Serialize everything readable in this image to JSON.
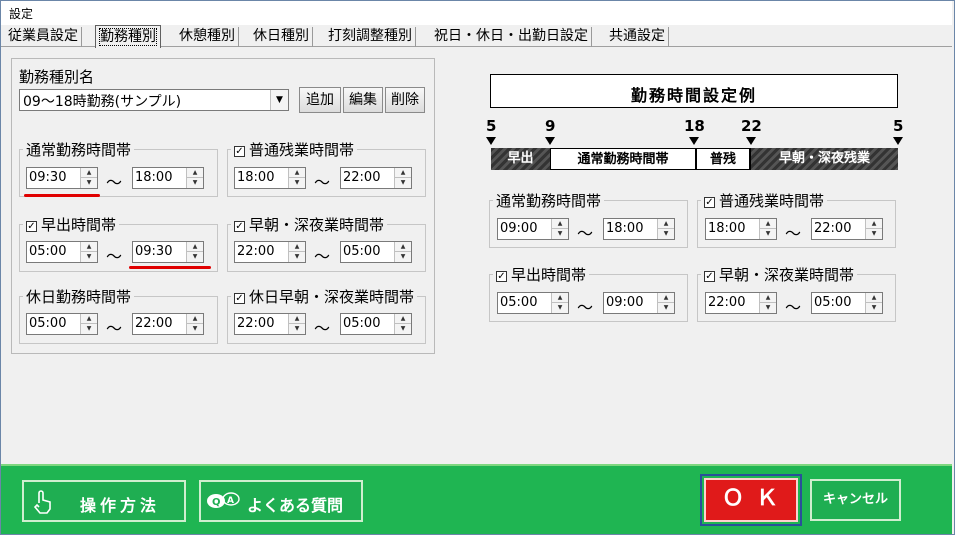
{
  "window": {
    "title": "設定"
  },
  "tabs": [
    "従業員設定",
    "勤務種別",
    "休憩種別",
    "休日種別",
    "打刻調整種別",
    "祝日・休日・出勤日設定",
    "共通設定"
  ],
  "left": {
    "type_label": "勤務種別名",
    "type_value": "09～18時勤務(サンプル)",
    "buttons": {
      "add": "追加",
      "edit": "編集",
      "delete": "削除"
    },
    "tilde": "～",
    "groups": {
      "normal": {
        "title": "通常勤務時間帯",
        "from": "09:30",
        "to": "18:00"
      },
      "overtime": {
        "title": "普通残業時間帯",
        "from": "18:00",
        "to": "22:00",
        "checked": true
      },
      "early": {
        "title": "早出時間帯",
        "from": "05:00",
        "to": "09:30",
        "checked": true
      },
      "latenight": {
        "title": "早朝・深夜業時間帯",
        "from": "22:00",
        "to": "05:00",
        "checked": true
      },
      "holiday": {
        "title": "休日勤務時間帯",
        "from": "05:00",
        "to": "22:00"
      },
      "holiday_late": {
        "title": "休日早朝・深夜業時間帯",
        "from": "22:00",
        "to": "05:00",
        "checked": true
      }
    }
  },
  "example": {
    "title": "勤務時間設定例",
    "marks": [
      "5",
      "9",
      "18",
      "22",
      "5"
    ],
    "segments": [
      "早出",
      "通常勤務時間帯",
      "普残",
      "早朝・深夜残業"
    ],
    "groups": {
      "normal": {
        "title": "通常勤務時間帯",
        "from": "09:00",
        "to": "18:00"
      },
      "overtime": {
        "title": "普通残業時間帯",
        "from": "18:00",
        "to": "22:00",
        "checked": true
      },
      "early": {
        "title": "早出時間帯",
        "from": "05:00",
        "to": "09:00",
        "checked": true
      },
      "latenight": {
        "title": "早朝・深夜業時間帯",
        "from": "22:00",
        "to": "05:00",
        "checked": true
      }
    }
  },
  "footer": {
    "howto": "操作方法",
    "faq": "よくある質問",
    "ok": "ＯＫ",
    "cancel": "キャンセル"
  },
  "colors": {
    "footer_green": "#1fb552",
    "ok_red": "#e01a1a",
    "highlight": "#e00000"
  },
  "check_mark": "✓"
}
